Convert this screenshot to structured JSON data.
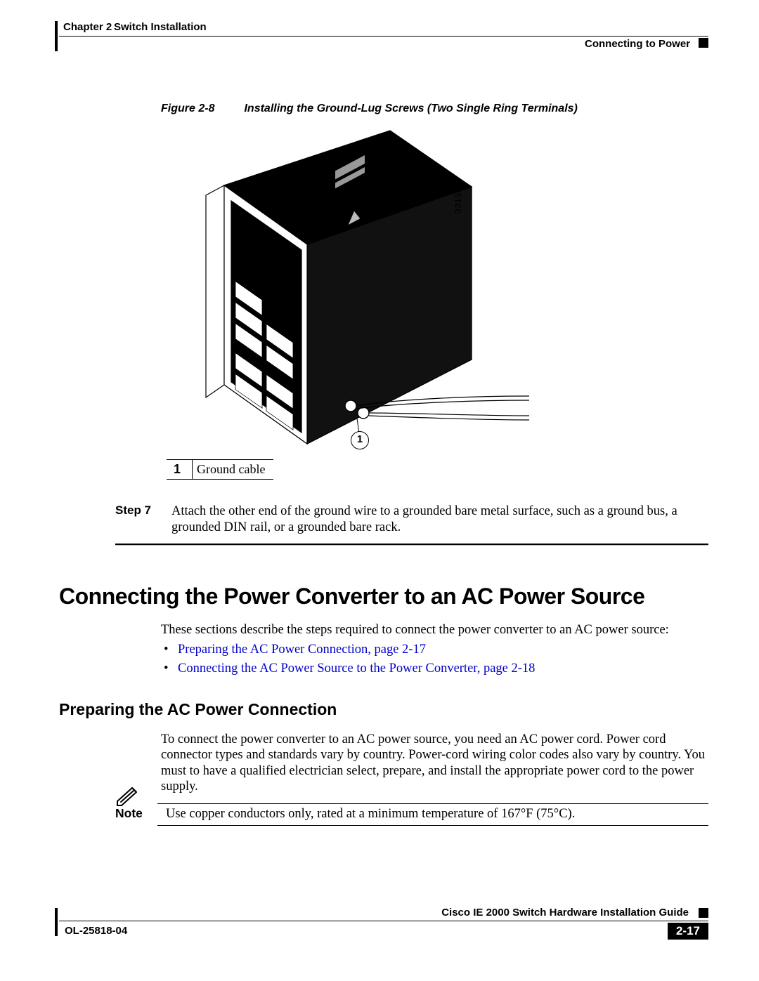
{
  "header": {
    "chapter_label": "Chapter 2",
    "chapter_title": "Switch Installation",
    "section": "Connecting to Power"
  },
  "figure": {
    "label": "Figure 2-8",
    "caption": "Installing the Ground-Lug Screws (Two Single Ring Terminals)",
    "part_number": "331555",
    "callout_1": "1",
    "legend": {
      "num": "1",
      "text": "Ground cable"
    }
  },
  "step": {
    "label": "Step 7",
    "text": "Attach the other end of the ground wire to a grounded bare metal surface, such as a ground bus, a grounded DIN rail, or a grounded bare rack."
  },
  "h1": "Connecting the Power Converter to an AC Power Source",
  "intro": "These sections describe the steps required to connect the power converter to an AC power source:",
  "links": {
    "l1": "Preparing the AC Power Connection, page 2-17",
    "l2": "Connecting the AC Power Source to the Power Converter, page 2-18"
  },
  "h2": "Preparing the AC Power Connection",
  "para1": "To connect the power converter to an AC power source, you need an AC power cord. Power cord connector types and standards vary by country. Power-cord wiring color codes also vary by country. You must to have a qualified electrician select, prepare, and install the appropriate power cord to the power supply.",
  "note": {
    "label": "Note",
    "text": "Use copper conductors only, rated at a minimum temperature of 167°F (75°C)."
  },
  "footer": {
    "guide": "Cisco IE 2000 Switch Hardware Installation Guide",
    "doc": "OL-25818-04",
    "page": "2-17"
  }
}
